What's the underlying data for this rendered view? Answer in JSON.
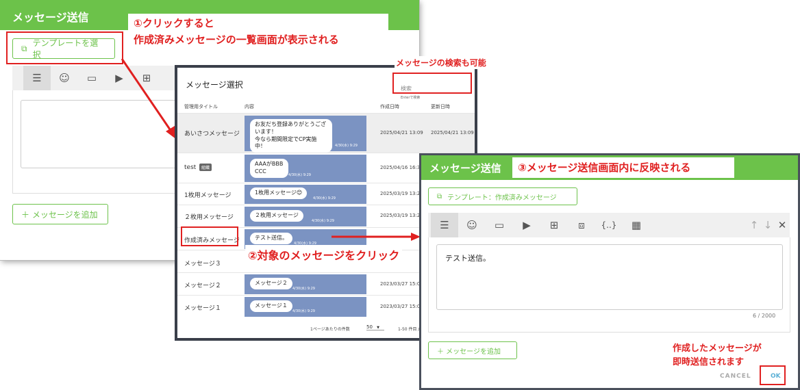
{
  "dialog_send_bg": {
    "title": "メッセージ送信",
    "template_button": "テンプレートを選択",
    "add_message_button": "＋ メッセージを追加"
  },
  "dialog_select": {
    "title": "メッセージ選択",
    "search": {
      "placeholder": "検索",
      "hint": "Enterで検索"
    },
    "columns": [
      "管理用タイトル",
      "内容",
      "作成日時",
      "更新日時"
    ],
    "rows": [
      {
        "title": "あいさつメッセージ",
        "badge": "",
        "content": "お友だち登録ありがとうございます！\n今なら期間限定でCP実施中！",
        "time": "4/30(水) 9:29",
        "created": "2025/04/21 13:09",
        "updated": "2025/04/21 13:09"
      },
      {
        "title": "test",
        "badge": "組織",
        "content": "AAAがBBB\nCCC",
        "time": "4/30(水) 9:29",
        "created": "2025/04/16 16:33",
        "updated": ""
      },
      {
        "title": "1枚用メッセージ",
        "badge": "",
        "content": "1枚用メッセージ😊",
        "time": "4/30(水) 9:29",
        "created": "2025/03/19 13:28",
        "updated": ""
      },
      {
        "title": "２枚用メッセージ",
        "badge": "",
        "content": "２枚用メッセージ",
        "time": "4/30(水) 9:29",
        "created": "2025/03/19 13:28",
        "updated": ""
      },
      {
        "title": "作成済みメッセージ",
        "badge": "",
        "content": "テスト送信。",
        "time": "4/30(水) 9:29",
        "created": "",
        "updated": ""
      },
      {
        "title": "メッセージ３",
        "badge": "",
        "content": "",
        "time": "",
        "created": "",
        "updated": ""
      },
      {
        "title": "メッセージ２",
        "badge": "",
        "content": "メッセージ２",
        "time": "4/30(水) 9:29",
        "created": "2023/03/27 15:02",
        "updated": ""
      },
      {
        "title": "メッセージ１",
        "badge": "",
        "content": "メッセージ１",
        "time": "4/30(水) 9:29",
        "created": "2023/03/27 15:01",
        "updated": ""
      }
    ],
    "footer": {
      "per_page_label": "1ページあたりの件数",
      "per_page_value": "50",
      "range": "1-50 件目 /"
    }
  },
  "dialog_send_result": {
    "title": "メッセージ送信",
    "template_button": "テンプレート：作成済みメッセージ",
    "message_text": "テスト送信。",
    "counter": "6 / 2000",
    "add_message_button": "＋ メッセージを追加",
    "cancel": "CANCEL",
    "ok": "OK",
    "toolbar_icons": [
      "text-icon",
      "sticker-icon",
      "image-icon",
      "video-icon",
      "imagemap-icon",
      "carousel-icon",
      "flex-icon",
      "template-icon"
    ]
  },
  "annotations": {
    "step1_line1": "①クリックすると",
    "step1_line2": "作成済みメッセージの一覧画面が表示される",
    "search_note": "メッセージの検索も可能",
    "step2": "②対象のメッセージをクリック",
    "step3": "③メッセージ送信画面内に反映される",
    "instant_line1": "作成したメッセージが",
    "instant_line2": "即時送信されます"
  },
  "colors": {
    "brand_green": "#6cc24a",
    "annotation_red": "#e02020",
    "bubble_bg": "#7b93c2"
  }
}
